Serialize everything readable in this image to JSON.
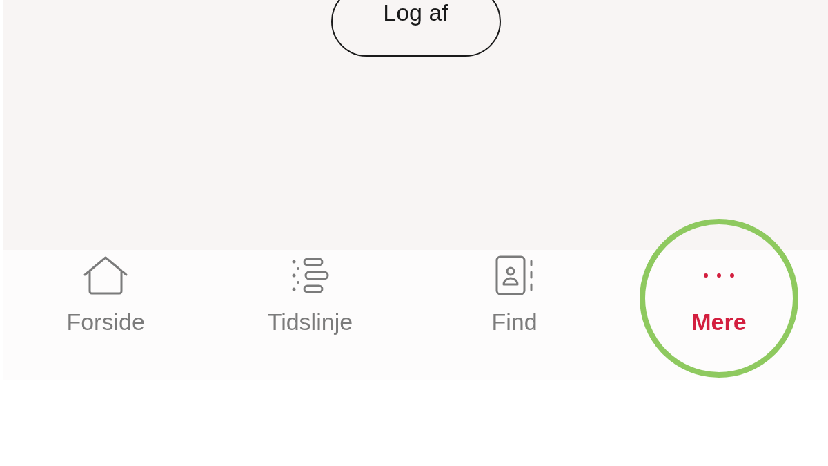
{
  "logout_button": {
    "label": "Log af"
  },
  "tabs": [
    {
      "label": "Forside",
      "kind": "home",
      "selected": false,
      "highlighted": false
    },
    {
      "label": "Tidslinje",
      "kind": "timeline",
      "selected": false,
      "highlighted": false
    },
    {
      "label": "Find",
      "kind": "contacts",
      "selected": false,
      "highlighted": false
    },
    {
      "label": "Mere",
      "kind": "more",
      "selected": true,
      "highlighted": true
    }
  ]
}
